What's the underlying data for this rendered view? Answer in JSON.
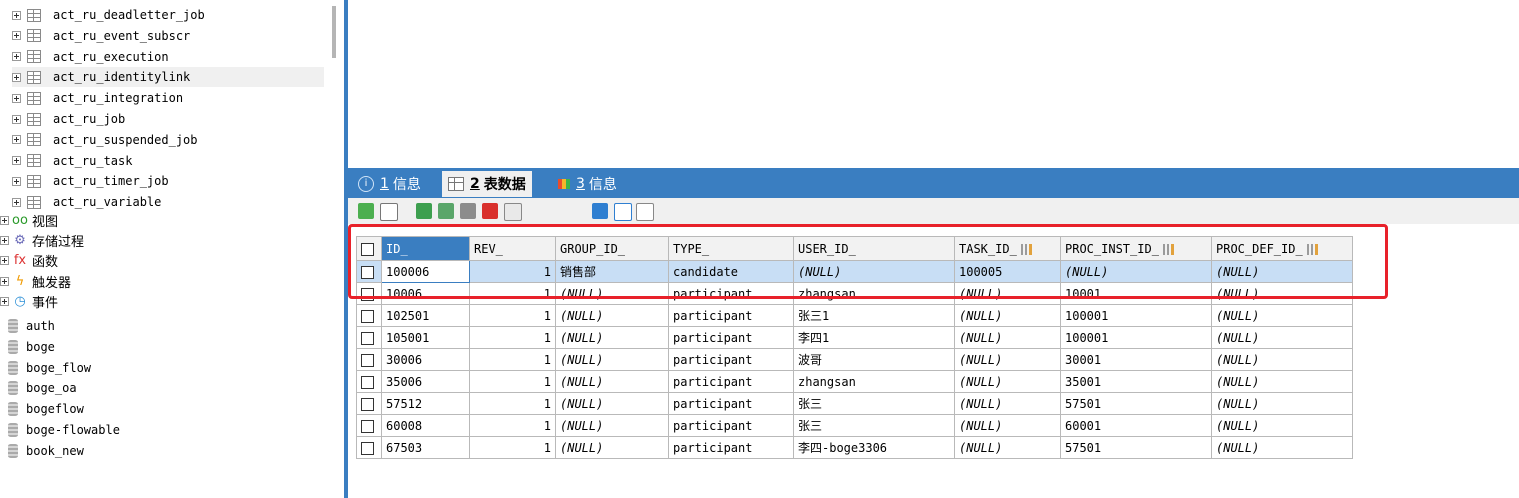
{
  "tree": {
    "tables": [
      "act_ru_deadletter_job",
      "act_ru_event_subscr",
      "act_ru_execution",
      "act_ru_identitylink",
      "act_ru_integration",
      "act_ru_job",
      "act_ru_suspended_job",
      "act_ru_task",
      "act_ru_timer_job",
      "act_ru_variable"
    ],
    "selected_table": "act_ru_identitylink",
    "categories": [
      {
        "label": "视图",
        "icon": "glasses-icon"
      },
      {
        "label": "存储过程",
        "icon": "gear-icon"
      },
      {
        "label": "函数",
        "icon": "function-icon"
      },
      {
        "label": "触发器",
        "icon": "lightning-icon"
      },
      {
        "label": "事件",
        "icon": "clock-icon"
      }
    ],
    "databases": [
      "auth",
      "boge",
      "boge_flow",
      "boge_oa",
      "bogeflow",
      "boge-flowable",
      "book_new"
    ]
  },
  "tabs": [
    {
      "num": "1",
      "label": "信息",
      "icon": "info-icon",
      "active": false
    },
    {
      "num": "2",
      "label": "表数据",
      "icon": "table-icon",
      "active": true
    },
    {
      "num": "3",
      "label": "信息",
      "icon": "chart-icon",
      "active": false
    }
  ],
  "toolbar": {
    "buttons": [
      "add-row-icon",
      "grid-options-icon",
      "insert-icon",
      "refresh-icon",
      "save-icon",
      "delete-icon",
      "filter-icon",
      "grid-view-icon",
      "form-view-icon",
      "text-view-icon"
    ]
  },
  "grid": {
    "columns": [
      "ID_",
      "REV_",
      "GROUP_ID_",
      "TYPE_",
      "USER_ID_",
      "TASK_ID_",
      "PROC_INST_ID_",
      "PROC_DEF_ID_"
    ],
    "rows": [
      [
        "100006",
        "1",
        "销售部",
        "candidate",
        "(NULL)",
        "100005",
        "(NULL)",
        "(NULL)"
      ],
      [
        "10006",
        "1",
        "(NULL)",
        "participant",
        "zhangsan",
        "(NULL)",
        "10001",
        "(NULL)"
      ],
      [
        "102501",
        "1",
        "(NULL)",
        "participant",
        "张三1",
        "(NULL)",
        "100001",
        "(NULL)"
      ],
      [
        "105001",
        "1",
        "(NULL)",
        "participant",
        "李四1",
        "(NULL)",
        "100001",
        "(NULL)"
      ],
      [
        "30006",
        "1",
        "(NULL)",
        "participant",
        "波哥",
        "(NULL)",
        "30001",
        "(NULL)"
      ],
      [
        "35006",
        "1",
        "(NULL)",
        "participant",
        "zhangsan",
        "(NULL)",
        "35001",
        "(NULL)"
      ],
      [
        "57512",
        "1",
        "(NULL)",
        "participant",
        "张三",
        "(NULL)",
        "57501",
        "(NULL)"
      ],
      [
        "60008",
        "1",
        "(NULL)",
        "participant",
        "张三",
        "(NULL)",
        "60001",
        "(NULL)"
      ],
      [
        "67503",
        "1",
        "(NULL)",
        "participant",
        "李四-boge3306",
        "(NULL)",
        "57501",
        "(NULL)"
      ]
    ],
    "selected_row": 0
  },
  "colors": {
    "accent": "#3a7ec1",
    "highlight_border": "#e8212a",
    "selected_row": "#c8def5"
  }
}
